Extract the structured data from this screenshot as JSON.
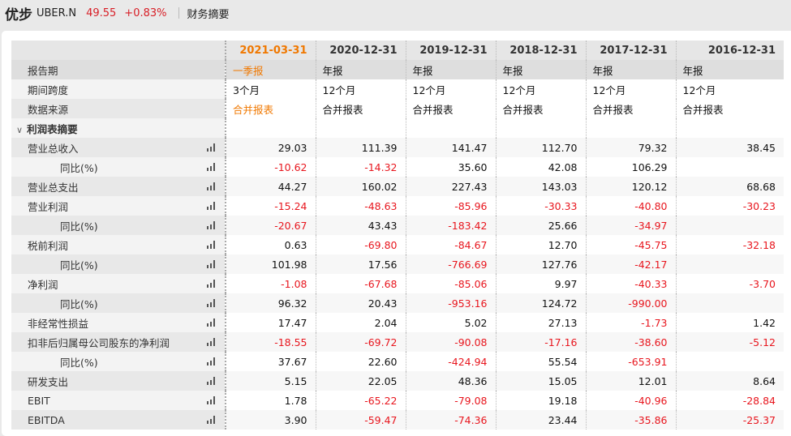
{
  "header": {
    "name": "优步",
    "code": "UBER.N",
    "price": "49.55",
    "change": "+0.83%",
    "section": "财务摘要"
  },
  "colors": {
    "negative": "#e8161e",
    "accent": "#f07800"
  },
  "periods": [
    "2021-03-31",
    "2020-12-31",
    "2019-12-31",
    "2018-12-31",
    "2017-12-31",
    "2016-12-31"
  ],
  "info_rows": [
    {
      "label": "报告期",
      "values": [
        "一季报",
        "年报",
        "年报",
        "年报",
        "年报",
        "年报"
      ]
    },
    {
      "label": "期间跨度",
      "values": [
        "3个月",
        "12个月",
        "12个月",
        "12个月",
        "12个月",
        "12个月"
      ]
    },
    {
      "label": "数据来源",
      "values": [
        "合并报表",
        "合并报表",
        "合并报表",
        "合并报表",
        "合并报表",
        "合并报表"
      ]
    }
  ],
  "section_label": "利润表摘要",
  "rows": [
    {
      "label": "营业总收入",
      "indent": false,
      "values": [
        "29.03",
        "111.39",
        "141.47",
        "112.70",
        "79.32",
        "38.45"
      ]
    },
    {
      "label": "同比(%)",
      "indent": true,
      "values": [
        "-10.62",
        "-14.32",
        "35.60",
        "42.08",
        "106.29",
        ""
      ]
    },
    {
      "label": "营业总支出",
      "indent": false,
      "values": [
        "44.27",
        "160.02",
        "227.43",
        "143.03",
        "120.12",
        "68.68"
      ]
    },
    {
      "label": "营业利润",
      "indent": false,
      "values": [
        "-15.24",
        "-48.63",
        "-85.96",
        "-30.33",
        "-40.80",
        "-30.23"
      ]
    },
    {
      "label": "同比(%)",
      "indent": true,
      "values": [
        "-20.67",
        "43.43",
        "-183.42",
        "25.66",
        "-34.97",
        ""
      ]
    },
    {
      "label": "税前利润",
      "indent": false,
      "values": [
        "0.63",
        "-69.80",
        "-84.67",
        "12.70",
        "-45.75",
        "-32.18"
      ]
    },
    {
      "label": "同比(%)",
      "indent": true,
      "values": [
        "101.98",
        "17.56",
        "-766.69",
        "127.76",
        "-42.17",
        ""
      ]
    },
    {
      "label": "净利润",
      "indent": false,
      "values": [
        "-1.08",
        "-67.68",
        "-85.06",
        "9.97",
        "-40.33",
        "-3.70"
      ]
    },
    {
      "label": "同比(%)",
      "indent": true,
      "values": [
        "96.32",
        "20.43",
        "-953.16",
        "124.72",
        "-990.00",
        ""
      ]
    },
    {
      "label": "非经常性损益",
      "indent": false,
      "values": [
        "17.47",
        "2.04",
        "5.02",
        "27.13",
        "-1.73",
        "1.42"
      ]
    },
    {
      "label": "扣非后归属母公司股东的净利润",
      "indent": false,
      "values": [
        "-18.55",
        "-69.72",
        "-90.08",
        "-17.16",
        "-38.60",
        "-5.12"
      ]
    },
    {
      "label": "同比(%)",
      "indent": true,
      "values": [
        "37.67",
        "22.60",
        "-424.94",
        "55.54",
        "-653.91",
        ""
      ]
    },
    {
      "label": "研发支出",
      "indent": false,
      "values": [
        "5.15",
        "22.05",
        "48.36",
        "15.05",
        "12.01",
        "8.64"
      ]
    },
    {
      "label": "EBIT",
      "indent": false,
      "values": [
        "1.78",
        "-65.22",
        "-79.08",
        "19.18",
        "-40.96",
        "-28.84"
      ]
    },
    {
      "label": "EBITDA",
      "indent": false,
      "values": [
        "3.90",
        "-59.47",
        "-74.36",
        "23.44",
        "-35.86",
        "-25.37"
      ]
    }
  ]
}
